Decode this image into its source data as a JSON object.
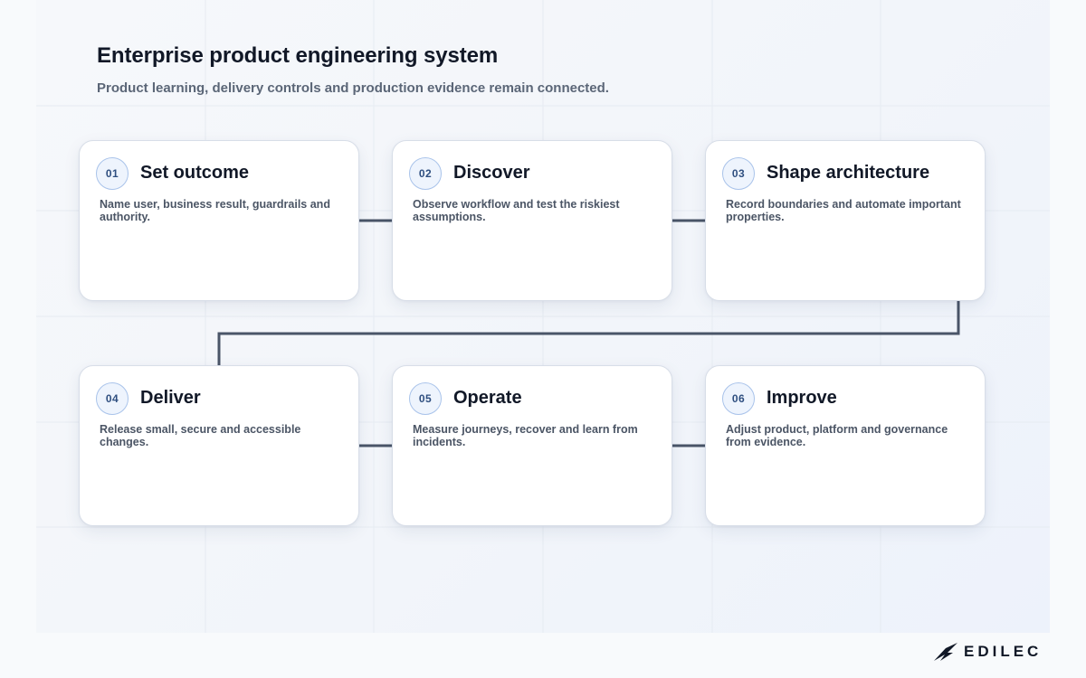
{
  "header": {
    "title": "Enterprise product engineering system",
    "subtitle": "Product learning, delivery controls and production evidence remain connected."
  },
  "steps": [
    {
      "number": "01",
      "title": "Set outcome",
      "description": "Name user, business result, guardrails and authority."
    },
    {
      "number": "02",
      "title": "Discover",
      "description": "Observe workflow and test the riskiest assumptions."
    },
    {
      "number": "03",
      "title": "Shape architecture",
      "description": "Record boundaries and automate important properties."
    },
    {
      "number": "04",
      "title": "Deliver",
      "description": "Release small, secure and accessible changes."
    },
    {
      "number": "05",
      "title": "Operate",
      "description": "Measure journeys, recover and learn from incidents."
    },
    {
      "number": "06",
      "title": "Improve",
      "description": "Adjust product, platform and governance from evidence."
    }
  ],
  "logo": {
    "text": "EDILEC",
    "icon": "edilec-logo-icon"
  },
  "colors": {
    "connector": "#4a5568",
    "badge_border": "#a9c3ea",
    "badge_text": "#2f4f80"
  }
}
